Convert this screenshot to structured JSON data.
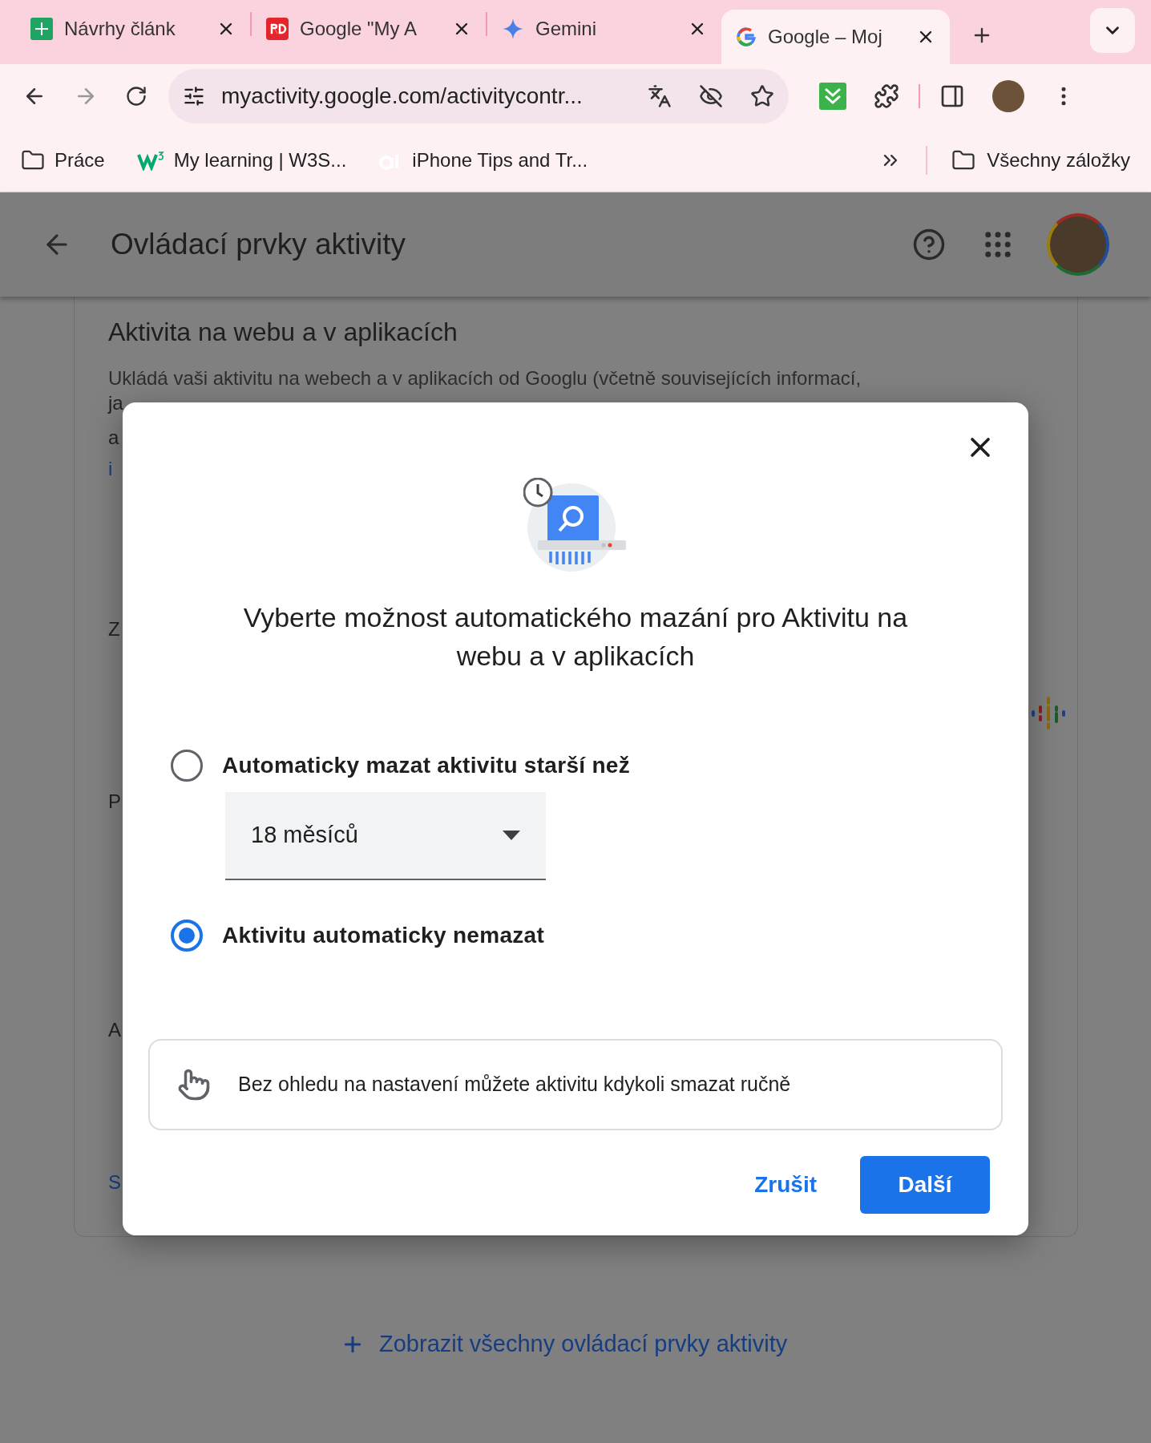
{
  "browser": {
    "tabs": [
      {
        "title": "Návrhy článk",
        "selected": false
      },
      {
        "title": "Google \"My A",
        "selected": false
      },
      {
        "title": "Gemini",
        "selected": false
      },
      {
        "title": "Google – Moj",
        "selected": true
      }
    ],
    "address": "myactivity.google.com/activitycontr...",
    "bookmarks": [
      {
        "label": "Práce"
      },
      {
        "label": "My learning | W3S..."
      },
      {
        "label": "iPhone Tips and Tr..."
      }
    ],
    "all_bookmarks": "Všechny záložky"
  },
  "header": {
    "title": "Ovládací prvky aktivity"
  },
  "card": {
    "heading": "Aktivita na webu a v aplikacích",
    "description": "Ukládá vaši aktivitu na webech a v aplikacích od Googlu (včetně souvisejících informací,",
    "fragments": [
      {
        "text": "ja",
        "kind": "text"
      },
      {
        "text": "a",
        "kind": "text"
      },
      {
        "text": "i",
        "kind": "link"
      },
      {
        "text": "Z",
        "kind": "text"
      },
      {
        "text": "P",
        "kind": "text"
      },
      {
        "text": "A",
        "kind": "text"
      },
      {
        "text": "S",
        "kind": "link"
      }
    ]
  },
  "dialog": {
    "title": "Vyberte možnost automatického mazání pro Aktivitu na webu a v aplikacích",
    "options": [
      {
        "label": "Automaticky mazat aktivitu starší než",
        "selected": false,
        "dropdown": "18 měsíců"
      },
      {
        "label": "Aktivitu automaticky nemazat",
        "selected": true
      }
    ],
    "note": "Bez ohledu na nastavení můžete aktivitu kdykoli smazat ručně",
    "buttons": [
      {
        "label": "Zrušit",
        "kind": "text"
      },
      {
        "label": "Další",
        "kind": "filled"
      }
    ]
  },
  "footer_link": "Zobrazit všechny ovládací prvky aktivity"
}
